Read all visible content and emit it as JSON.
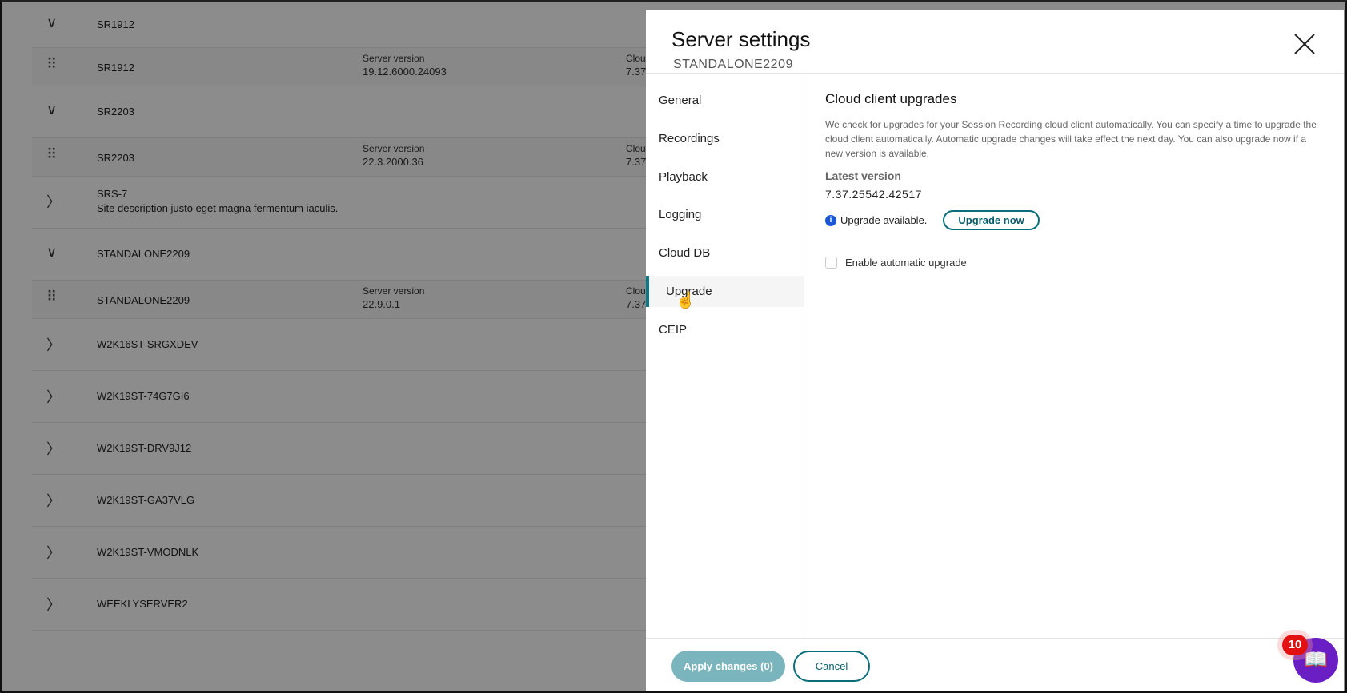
{
  "server_list": [
    {
      "type": "group",
      "name": "SR1912",
      "expanded": true
    },
    {
      "type": "server",
      "name": "SR1912",
      "server_version_label": "Server version",
      "server_version": "19.12.6000.24093",
      "cloud_label": "Clou",
      "cloud_value": "7.37"
    },
    {
      "type": "group",
      "name": "SR2203",
      "expanded": true
    },
    {
      "type": "server",
      "name": "SR2203",
      "server_version_label": "Server version",
      "server_version": "22.3.2000.36",
      "cloud_label": "Clou",
      "cloud_value": "7.37"
    },
    {
      "type": "group",
      "name": "SRS-7",
      "description": "Site description justo eget magna fermentum iaculis.",
      "expanded": false
    },
    {
      "type": "group",
      "name": "STANDALONE2209",
      "expanded": true
    },
    {
      "type": "server",
      "name": "STANDALONE2209",
      "server_version_label": "Server version",
      "server_version": "22.9.0.1",
      "cloud_label": "Clou",
      "cloud_value": "7.37"
    },
    {
      "type": "group",
      "name": "W2K16ST-SRGXDEV",
      "expanded": false
    },
    {
      "type": "group",
      "name": "W2K19ST-74G7GI6",
      "expanded": false
    },
    {
      "type": "group",
      "name": "W2K19ST-DRV9J12",
      "expanded": false
    },
    {
      "type": "group",
      "name": "W2K19ST-GA37VLG",
      "expanded": false
    },
    {
      "type": "group",
      "name": "W2K19ST-VMODNLK",
      "expanded": false
    },
    {
      "type": "group",
      "name": "WEEKLYSERVER2",
      "expanded": false
    }
  ],
  "panel": {
    "title": "Server settings",
    "subtitle": "STANDALONE2209",
    "nav": [
      "General",
      "Recordings",
      "Playback",
      "Logging",
      "Cloud DB",
      "Upgrade",
      "CEIP"
    ],
    "active_nav": "Upgrade",
    "heading": "Cloud client upgrades",
    "description": "We check for upgrades for your Session Recording cloud client automatically. You can specify a time to upgrade the cloud client automatically. Automatic upgrade changes will take effect the next day. You can also upgrade now if a new version is available.",
    "latest_version_label": "Latest version",
    "latest_version": "7.37.25542.42517",
    "upgrade_available": "Upgrade available.",
    "upgrade_now": "Upgrade now",
    "auto_upgrade_label": "Enable automatic upgrade",
    "auto_upgrade_checked": false,
    "apply": "Apply changes (0)",
    "cancel": "Cancel"
  },
  "help": {
    "badge": "10"
  },
  "colors": {
    "accent": "#0a6e7a",
    "help": "#6a1fc4",
    "badge": "#e21010",
    "info": "#1a56d6"
  }
}
